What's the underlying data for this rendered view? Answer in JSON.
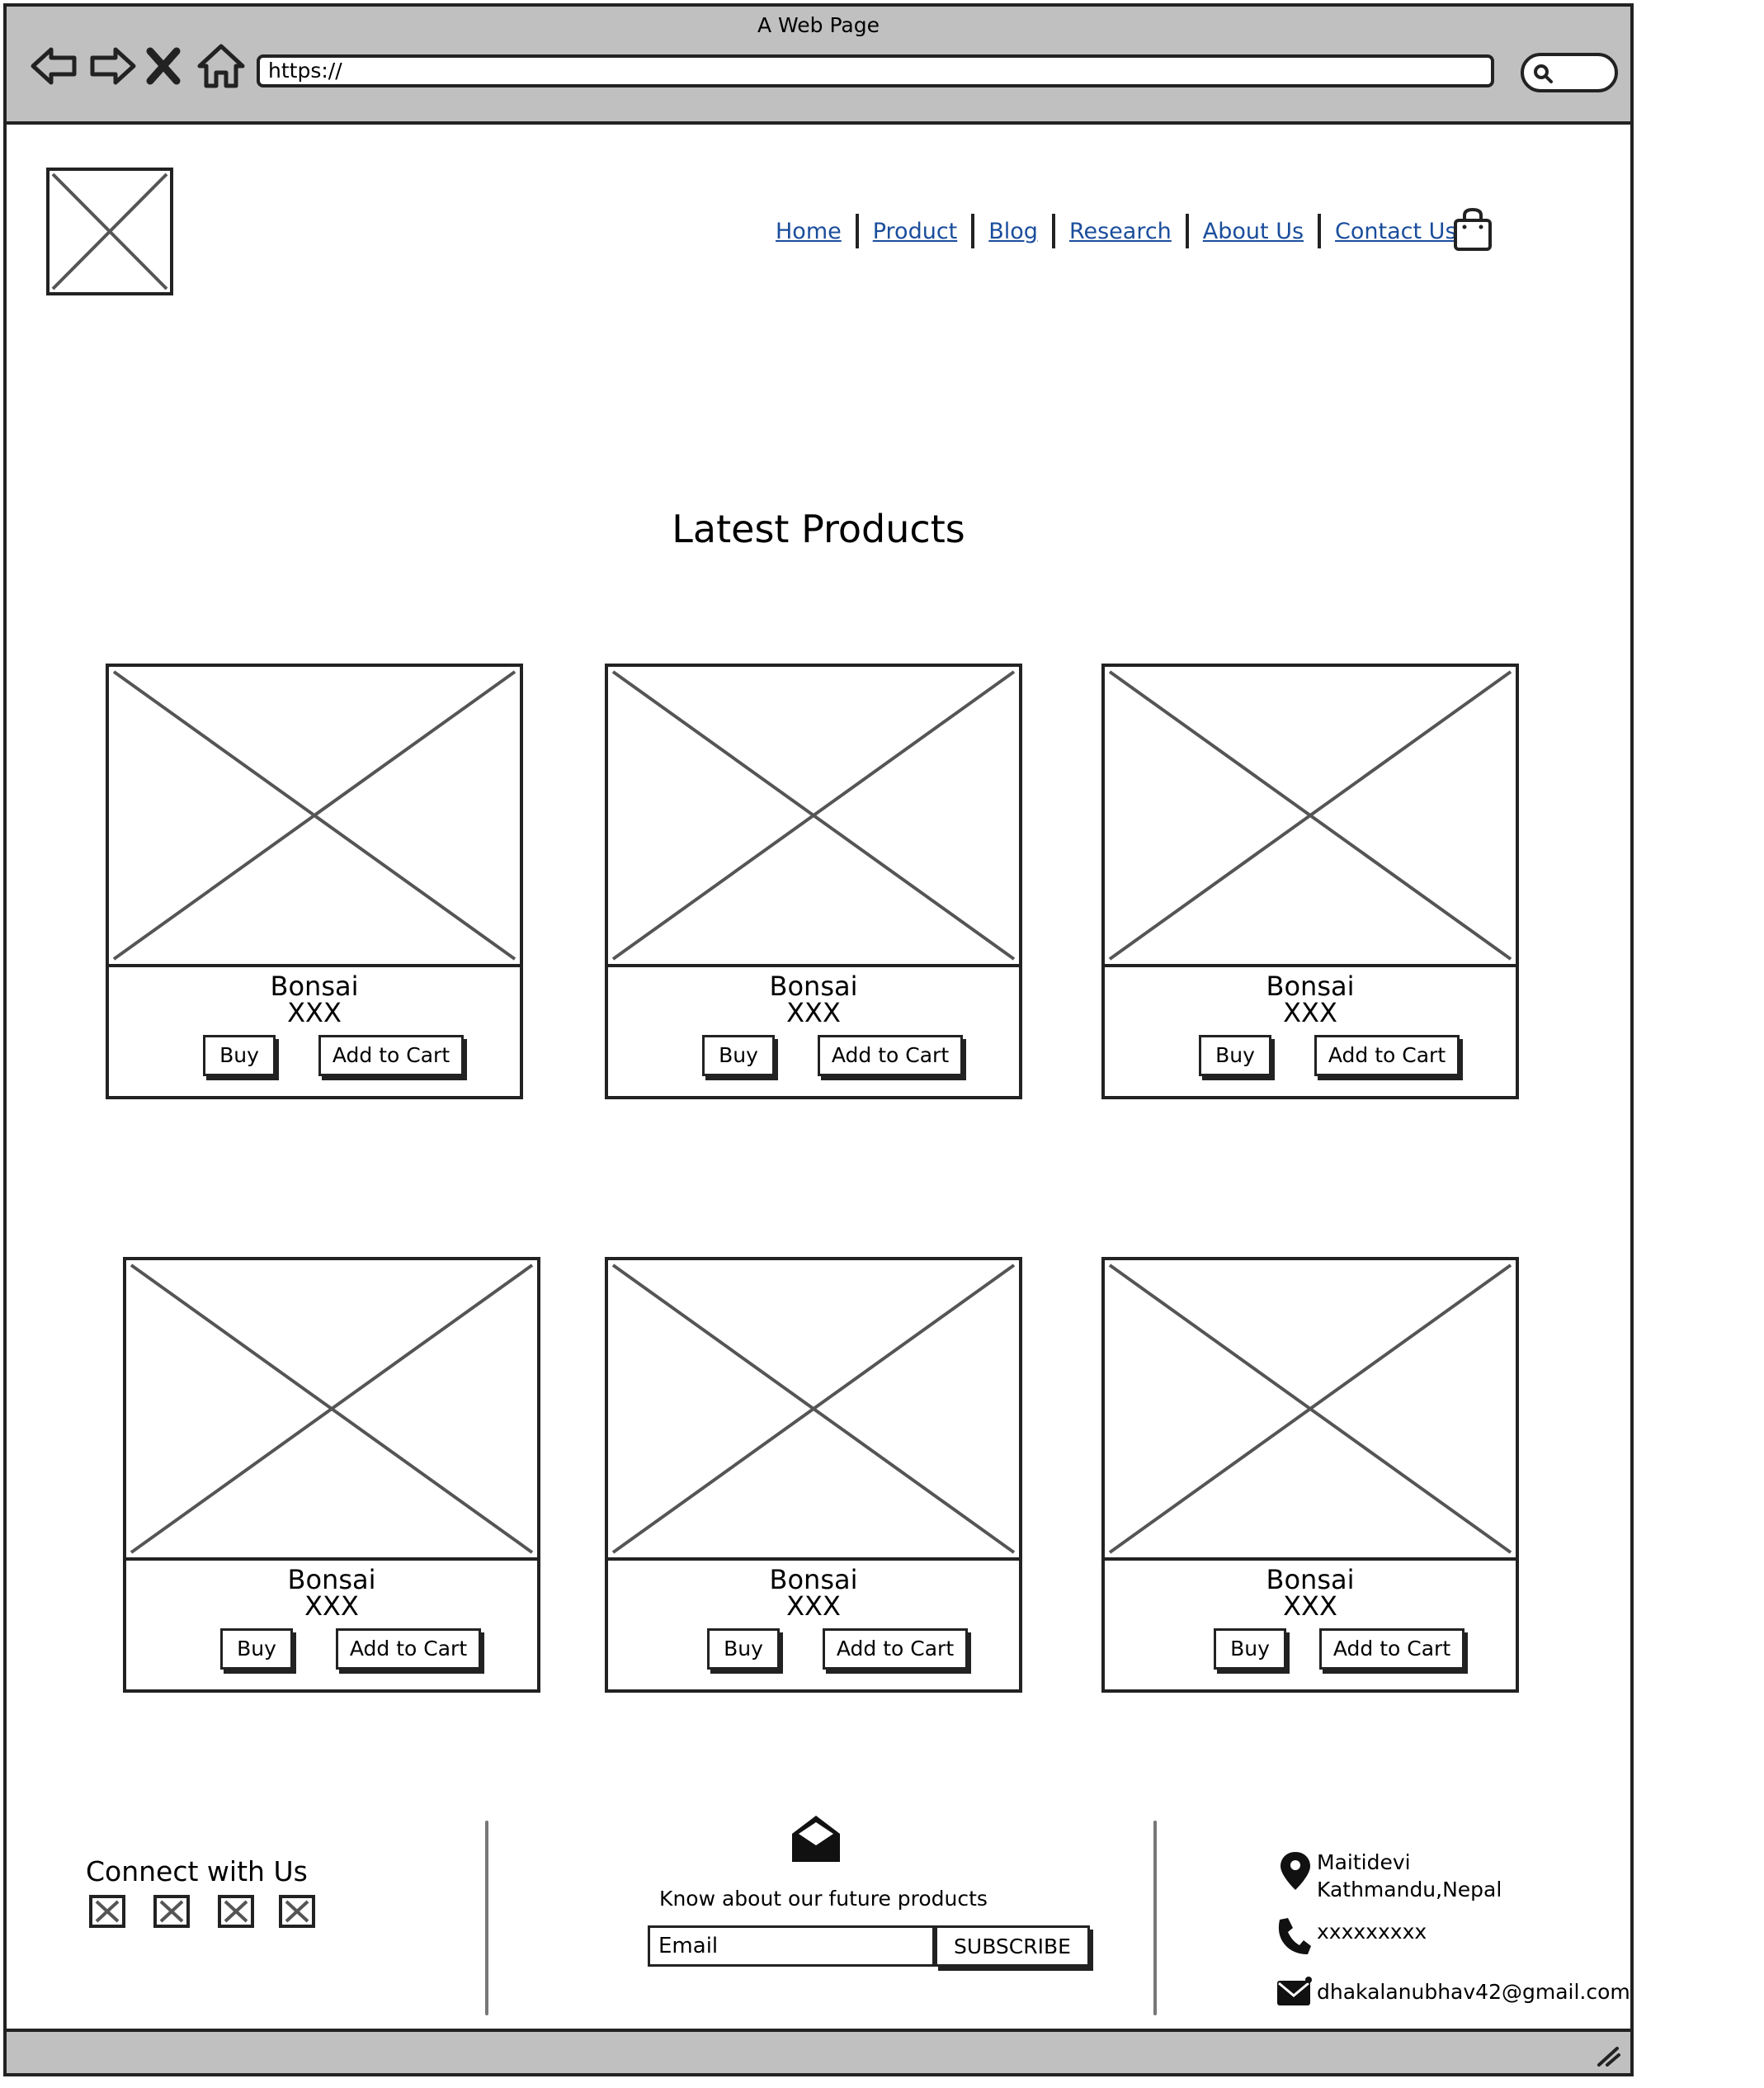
{
  "window": {
    "title": "A Web Page"
  },
  "address_bar": {
    "url": "https://"
  },
  "nav": {
    "links": [
      "Home",
      "Product",
      "Blog",
      "Research",
      "About Us",
      "Contact Us"
    ]
  },
  "section": {
    "title": "Latest Products"
  },
  "products": [
    {
      "name": "Bonsai",
      "price": "XXX",
      "buy_label": "Buy",
      "cart_label": "Add to Cart"
    },
    {
      "name": "Bonsai",
      "price": "XXX",
      "buy_label": "Buy",
      "cart_label": "Add to Cart"
    },
    {
      "name": "Bonsai",
      "price": "XXX",
      "buy_label": "Buy",
      "cart_label": "Add to Cart"
    },
    {
      "name": "Bonsai",
      "price": "XXX",
      "buy_label": "Buy",
      "cart_label": "Add to Cart"
    },
    {
      "name": "Bonsai",
      "price": "XXX",
      "buy_label": "Buy",
      "cart_label": "Add to Cart"
    },
    {
      "name": "Bonsai",
      "price": "XXX",
      "buy_label": "Buy",
      "cart_label": "Add to Cart"
    }
  ],
  "footer": {
    "connect_title": "Connect with Us",
    "newsletter_text": "Know about our future products",
    "email_placeholder": "Email",
    "subscribe_label": "SUBSCRIBE",
    "address_line1": "Maitidevi",
    "address_line2": "Kathmandu,Nepal",
    "phone": "xxxxxxxxx",
    "email": "dhakalanubhav42@gmail.com"
  },
  "colors": {
    "link": "#1a4d9c",
    "chrome": "#c0c0c0",
    "stroke": "#222222"
  },
  "icons": {
    "nav_buttons": [
      "back-arrow-icon",
      "forward-arrow-icon",
      "close-icon",
      "home-icon"
    ],
    "cart": "shopping-bag-icon",
    "newsletter": "open-envelope-icon",
    "contact": [
      "location-pin-icon",
      "phone-icon",
      "mail-icon"
    ]
  }
}
